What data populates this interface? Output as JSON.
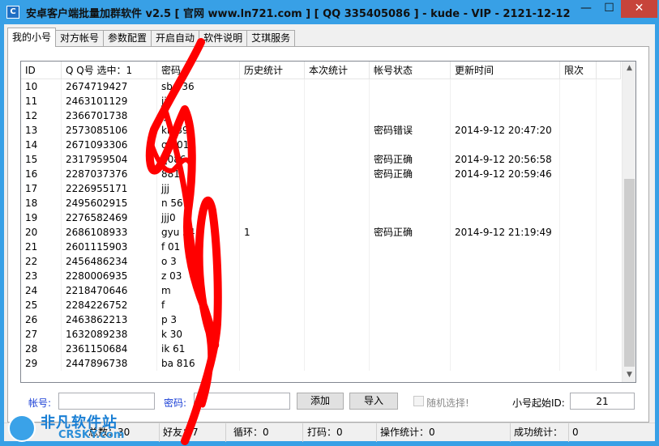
{
  "window": {
    "title": "安卓客户端批量加群软件 v2.5 [ 官网 www.ln721.com ] [ QQ 335405086 ] - kude - VIP - 2121-12-12",
    "app_icon_glyph": "C",
    "min_glyph": "—",
    "max_glyph": "☐",
    "close_glyph": "✕",
    "accent_color": "#38a0e6",
    "close_color": "#c7443b"
  },
  "tabs": [
    {
      "label": "我的小号",
      "active": true
    },
    {
      "label": "对方帐号"
    },
    {
      "label": "参数配置"
    },
    {
      "label": "开启自动"
    },
    {
      "label": "软件说明"
    },
    {
      "label": "艾琪服务"
    }
  ],
  "table": {
    "columns": [
      "ID",
      "Q Q号  选中：1",
      "密码",
      "历史统计",
      "本次统计",
      "帐号状态",
      "更新时间",
      "限次"
    ],
    "rows": [
      {
        "id": "10",
        "qq": "2674719427",
        "pwd": "sb   936",
        "hist": "",
        "cur": "",
        "status": "",
        "time": "",
        "limit": ""
      },
      {
        "id": "11",
        "qq": "2463101129",
        "pwd": "jjj",
        "hist": "",
        "cur": "",
        "status": "",
        "time": "",
        "limit": ""
      },
      {
        "id": "12",
        "qq": "2366701738",
        "pwd": "jjj",
        "hist": "",
        "cur": "",
        "status": "",
        "time": "",
        "limit": ""
      },
      {
        "id": "13",
        "qq": "2573085106",
        "pwd": "kn   392",
        "hist": "",
        "cur": "",
        "status": "密码错误",
        "time": "2014-9-12 20:47:20",
        "limit": ""
      },
      {
        "id": "14",
        "qq": "2671093306",
        "pwd": "q    301",
        "hist": "",
        "cur": "",
        "status": "",
        "time": "",
        "limit": ""
      },
      {
        "id": "15",
        "qq": "2317959504",
        "pwd": "     q086",
        "hist": "",
        "cur": "",
        "status": "密码正确",
        "time": "2014-9-12 20:56:58",
        "limit": ""
      },
      {
        "id": "16",
        "qq": "2287037376",
        "pwd": "     881",
        "hist": "",
        "cur": "",
        "status": "密码正确",
        "time": "2014-9-12 20:59:46",
        "limit": ""
      },
      {
        "id": "17",
        "qq": "2226955171",
        "pwd": "jjj",
        "hist": "",
        "cur": "",
        "status": "",
        "time": "",
        "limit": ""
      },
      {
        "id": "18",
        "qq": "2495602915",
        "pwd": "n    561",
        "hist": "",
        "cur": "",
        "status": "",
        "time": "",
        "limit": ""
      },
      {
        "id": "19",
        "qq": "2276582469",
        "pwd": "jjj0",
        "hist": "",
        "cur": "",
        "status": "",
        "time": "",
        "limit": ""
      },
      {
        "id": "20",
        "qq": "2686108933",
        "pwd": "gyu    54",
        "hist": "1",
        "cur": "",
        "status": "密码正确",
        "time": "2014-9-12 21:19:49",
        "limit": ""
      },
      {
        "id": "21",
        "qq": "2601115903",
        "pwd": "f    01",
        "hist": "",
        "cur": "",
        "status": "",
        "time": "",
        "limit": ""
      },
      {
        "id": "22",
        "qq": "2456486234",
        "pwd": "o    3",
        "hist": "",
        "cur": "",
        "status": "",
        "time": "",
        "limit": ""
      },
      {
        "id": "23",
        "qq": "2280006935",
        "pwd": "z    03",
        "hist": "",
        "cur": "",
        "status": "",
        "time": "",
        "limit": ""
      },
      {
        "id": "24",
        "qq": "2218470646",
        "pwd": "m",
        "hist": "",
        "cur": "",
        "status": "",
        "time": "",
        "limit": ""
      },
      {
        "id": "25",
        "qq": "2284226752",
        "pwd": "f",
        "hist": "",
        "cur": "",
        "status": "",
        "time": "",
        "limit": ""
      },
      {
        "id": "26",
        "qq": "2463862213",
        "pwd": "p    3",
        "hist": "",
        "cur": "",
        "status": "",
        "time": "",
        "limit": ""
      },
      {
        "id": "27",
        "qq": "1632089238",
        "pwd": "k    30",
        "hist": "",
        "cur": "",
        "status": "",
        "time": "",
        "limit": ""
      },
      {
        "id": "28",
        "qq": "2361150684",
        "pwd": "ik   61",
        "hist": "",
        "cur": "",
        "status": "",
        "time": "",
        "limit": ""
      },
      {
        "id": "29",
        "qq": "2447896738",
        "pwd": "ba    816",
        "hist": "",
        "cur": "",
        "status": "",
        "time": "",
        "limit": ""
      }
    ]
  },
  "form": {
    "account_label": "帐号:",
    "account_value": "",
    "password_label": "密码:",
    "password_value": "",
    "add_button": "添加",
    "import_button": "导入",
    "random_select_label": "随机选择!",
    "start_id_label": "小号起始ID:",
    "start_id_value": "21"
  },
  "statusbar": {
    "total_label": "总数：30",
    "friends_label": "好友：7",
    "loop_label": "循环：0",
    "captcha_label": "打码：0",
    "ops_label": "操作统计：0",
    "success_label": "成功统计：",
    "success_value": "0"
  },
  "watermark": {
    "main_text": "非凡软件站",
    "sub_text": "CRSKY.com"
  }
}
